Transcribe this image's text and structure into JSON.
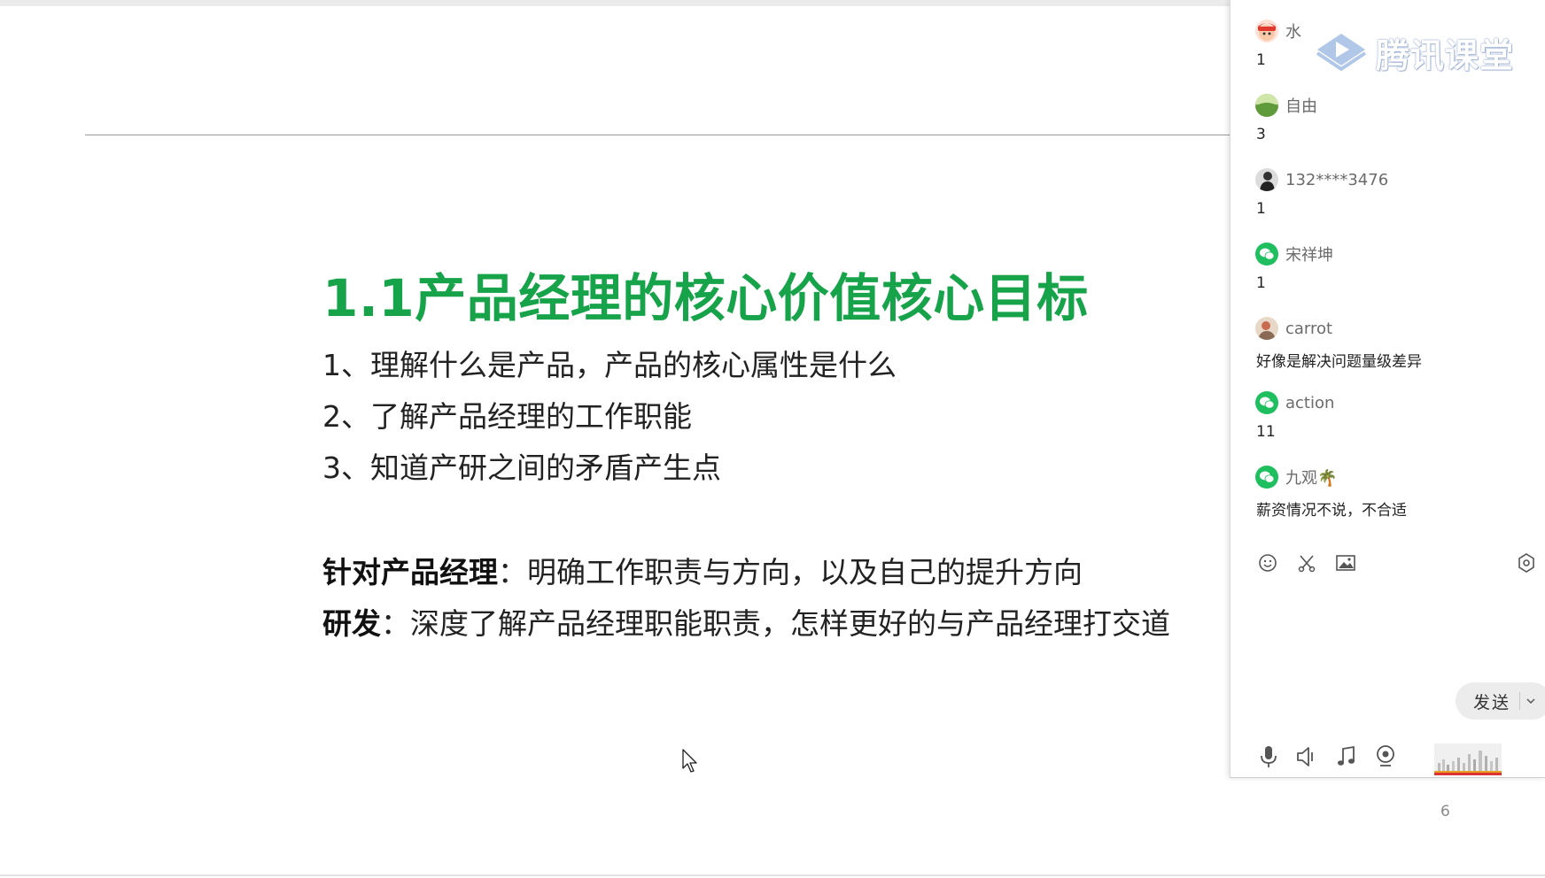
{
  "slide": {
    "title": "1.1产品经理的核心价值核心目标",
    "goals": [
      "1、理解什么是产品，产品的核心属性是什么",
      "2、了解产品经理的工作职能",
      "3、知道产研之间的矛盾产生点"
    ],
    "notes": [
      {
        "label": "针对产品经理",
        "text": "：明确工作职责与方向，以及自己的提升方向"
      },
      {
        "label": "研发",
        "text": "：深度了解产品经理职能职责，怎样更好的与产品经理打交道"
      }
    ],
    "page_number": "6",
    "title_color": "#17a34a"
  },
  "chat": {
    "brand": "腾讯课堂",
    "messages": [
      {
        "sender": "水",
        "text": "1",
        "avatar": "cartoon-avatar-icon"
      },
      {
        "sender": "自由",
        "text": "3",
        "avatar": "landscape-avatar-icon"
      },
      {
        "sender": "132****3476",
        "text": "1",
        "avatar": "person-avatar-icon"
      },
      {
        "sender": "宋祥坤",
        "text": "1",
        "avatar": "wechat-avatar-icon"
      },
      {
        "sender": "carrot",
        "text": "好像是解决问题量级差异",
        "avatar": "photo-avatar-icon"
      },
      {
        "sender": "action",
        "text": "11",
        "avatar": "wechat-avatar-icon"
      },
      {
        "sender": "九观🌴",
        "text": "薪资情况不说，不合适",
        "avatar": "wechat-avatar-icon"
      }
    ],
    "tools": [
      "emoji-icon",
      "scissors-icon",
      "image-icon",
      "settings-icon"
    ],
    "send_label": "发送",
    "media": [
      "microphone-icon",
      "speaker-icon",
      "music-icon",
      "camera-icon"
    ]
  }
}
